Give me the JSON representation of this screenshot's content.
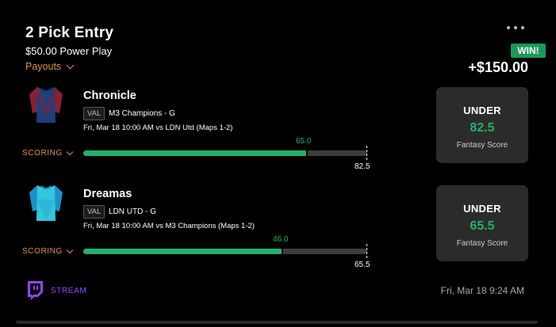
{
  "entry": {
    "title": "2 Pick Entry",
    "subtitle": "$50.00 Power Play",
    "payouts_label": "Payouts",
    "result_badge": "WIN!",
    "win_amount": "+$150.00"
  },
  "picks": [
    {
      "player": "Chronicle",
      "game_tag": "VAL",
      "team": "M3 Champions - G",
      "game_info": "Fri, Mar 18 10:00 AM  vs LDN Utd (Maps 1-2)",
      "scoring_label": "SCORING",
      "actual": "65.0",
      "target": "82.5",
      "progress_fraction": 0.787,
      "direction": "UNDER",
      "line": "82.5",
      "stat": "Fantasy Score",
      "jersey_colors": {
        "body": "#1f3f7a",
        "sleeve": "#8a1f33"
      }
    },
    {
      "player": "Dreamas",
      "game_tag": "VAL",
      "team": "LDN UTD - G",
      "game_info": "Fri, Mar 18 10:00 AM  vs M3 Champions (Maps 1-2)",
      "scoring_label": "SCORING",
      "actual": "46.0",
      "target": "65.5",
      "progress_fraction": 0.702,
      "direction": "UNDER",
      "line": "65.5",
      "stat": "Fantasy Score",
      "jersey_colors": {
        "body": "#33c7de",
        "sleeve": "#1e90c8"
      }
    }
  ],
  "footer": {
    "stream_label": "STREAM",
    "timestamp": "Fri, Mar 18 9:24 AM"
  },
  "colors": {
    "accent_green": "#22b06a",
    "accent_orange": "#e0933a",
    "twitch_purple": "#9146ff"
  },
  "icons": [
    "more-options-icon",
    "chevron-down-icon",
    "jersey-icon",
    "twitch-icon"
  ]
}
